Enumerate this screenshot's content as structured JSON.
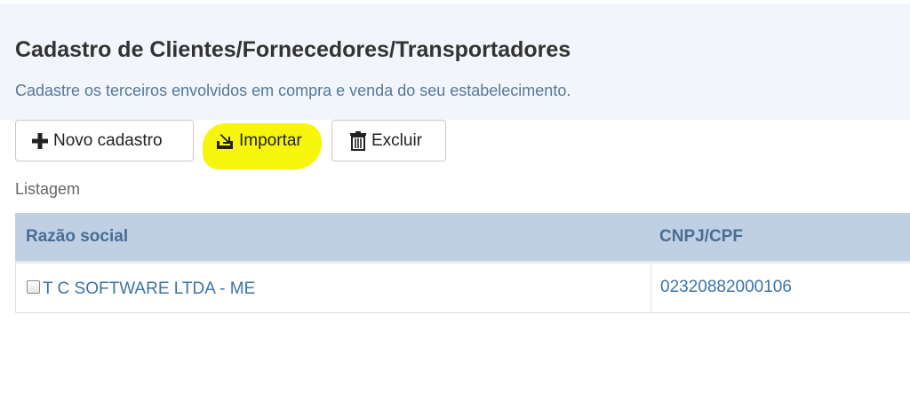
{
  "header": {
    "title": "Cadastro de Clientes/Fornecedores/Transportadores",
    "subtitle": "Cadastre os terceiros envolvidos em compra e venda do seu estabelecimento."
  },
  "toolbar": {
    "new_label": "Novo cadastro",
    "import_label": "Importar",
    "delete_label": "Excluir",
    "icons": {
      "new": "plus-icon",
      "import": "import-icon",
      "delete": "trash-icon"
    }
  },
  "listing": {
    "label": "Listagem",
    "columns": [
      "Razão social",
      "CNPJ/CPF"
    ],
    "rows": [
      {
        "razao_social": "T C SOFTWARE LTDA - ME",
        "cnpj_cpf": "02320882000106",
        "selected": false
      }
    ]
  },
  "colors": {
    "header_bg": "#f2f5fb",
    "table_header_bg": "#bfd0e5",
    "link": "#3b74a8",
    "highlight": "#f8f400"
  }
}
